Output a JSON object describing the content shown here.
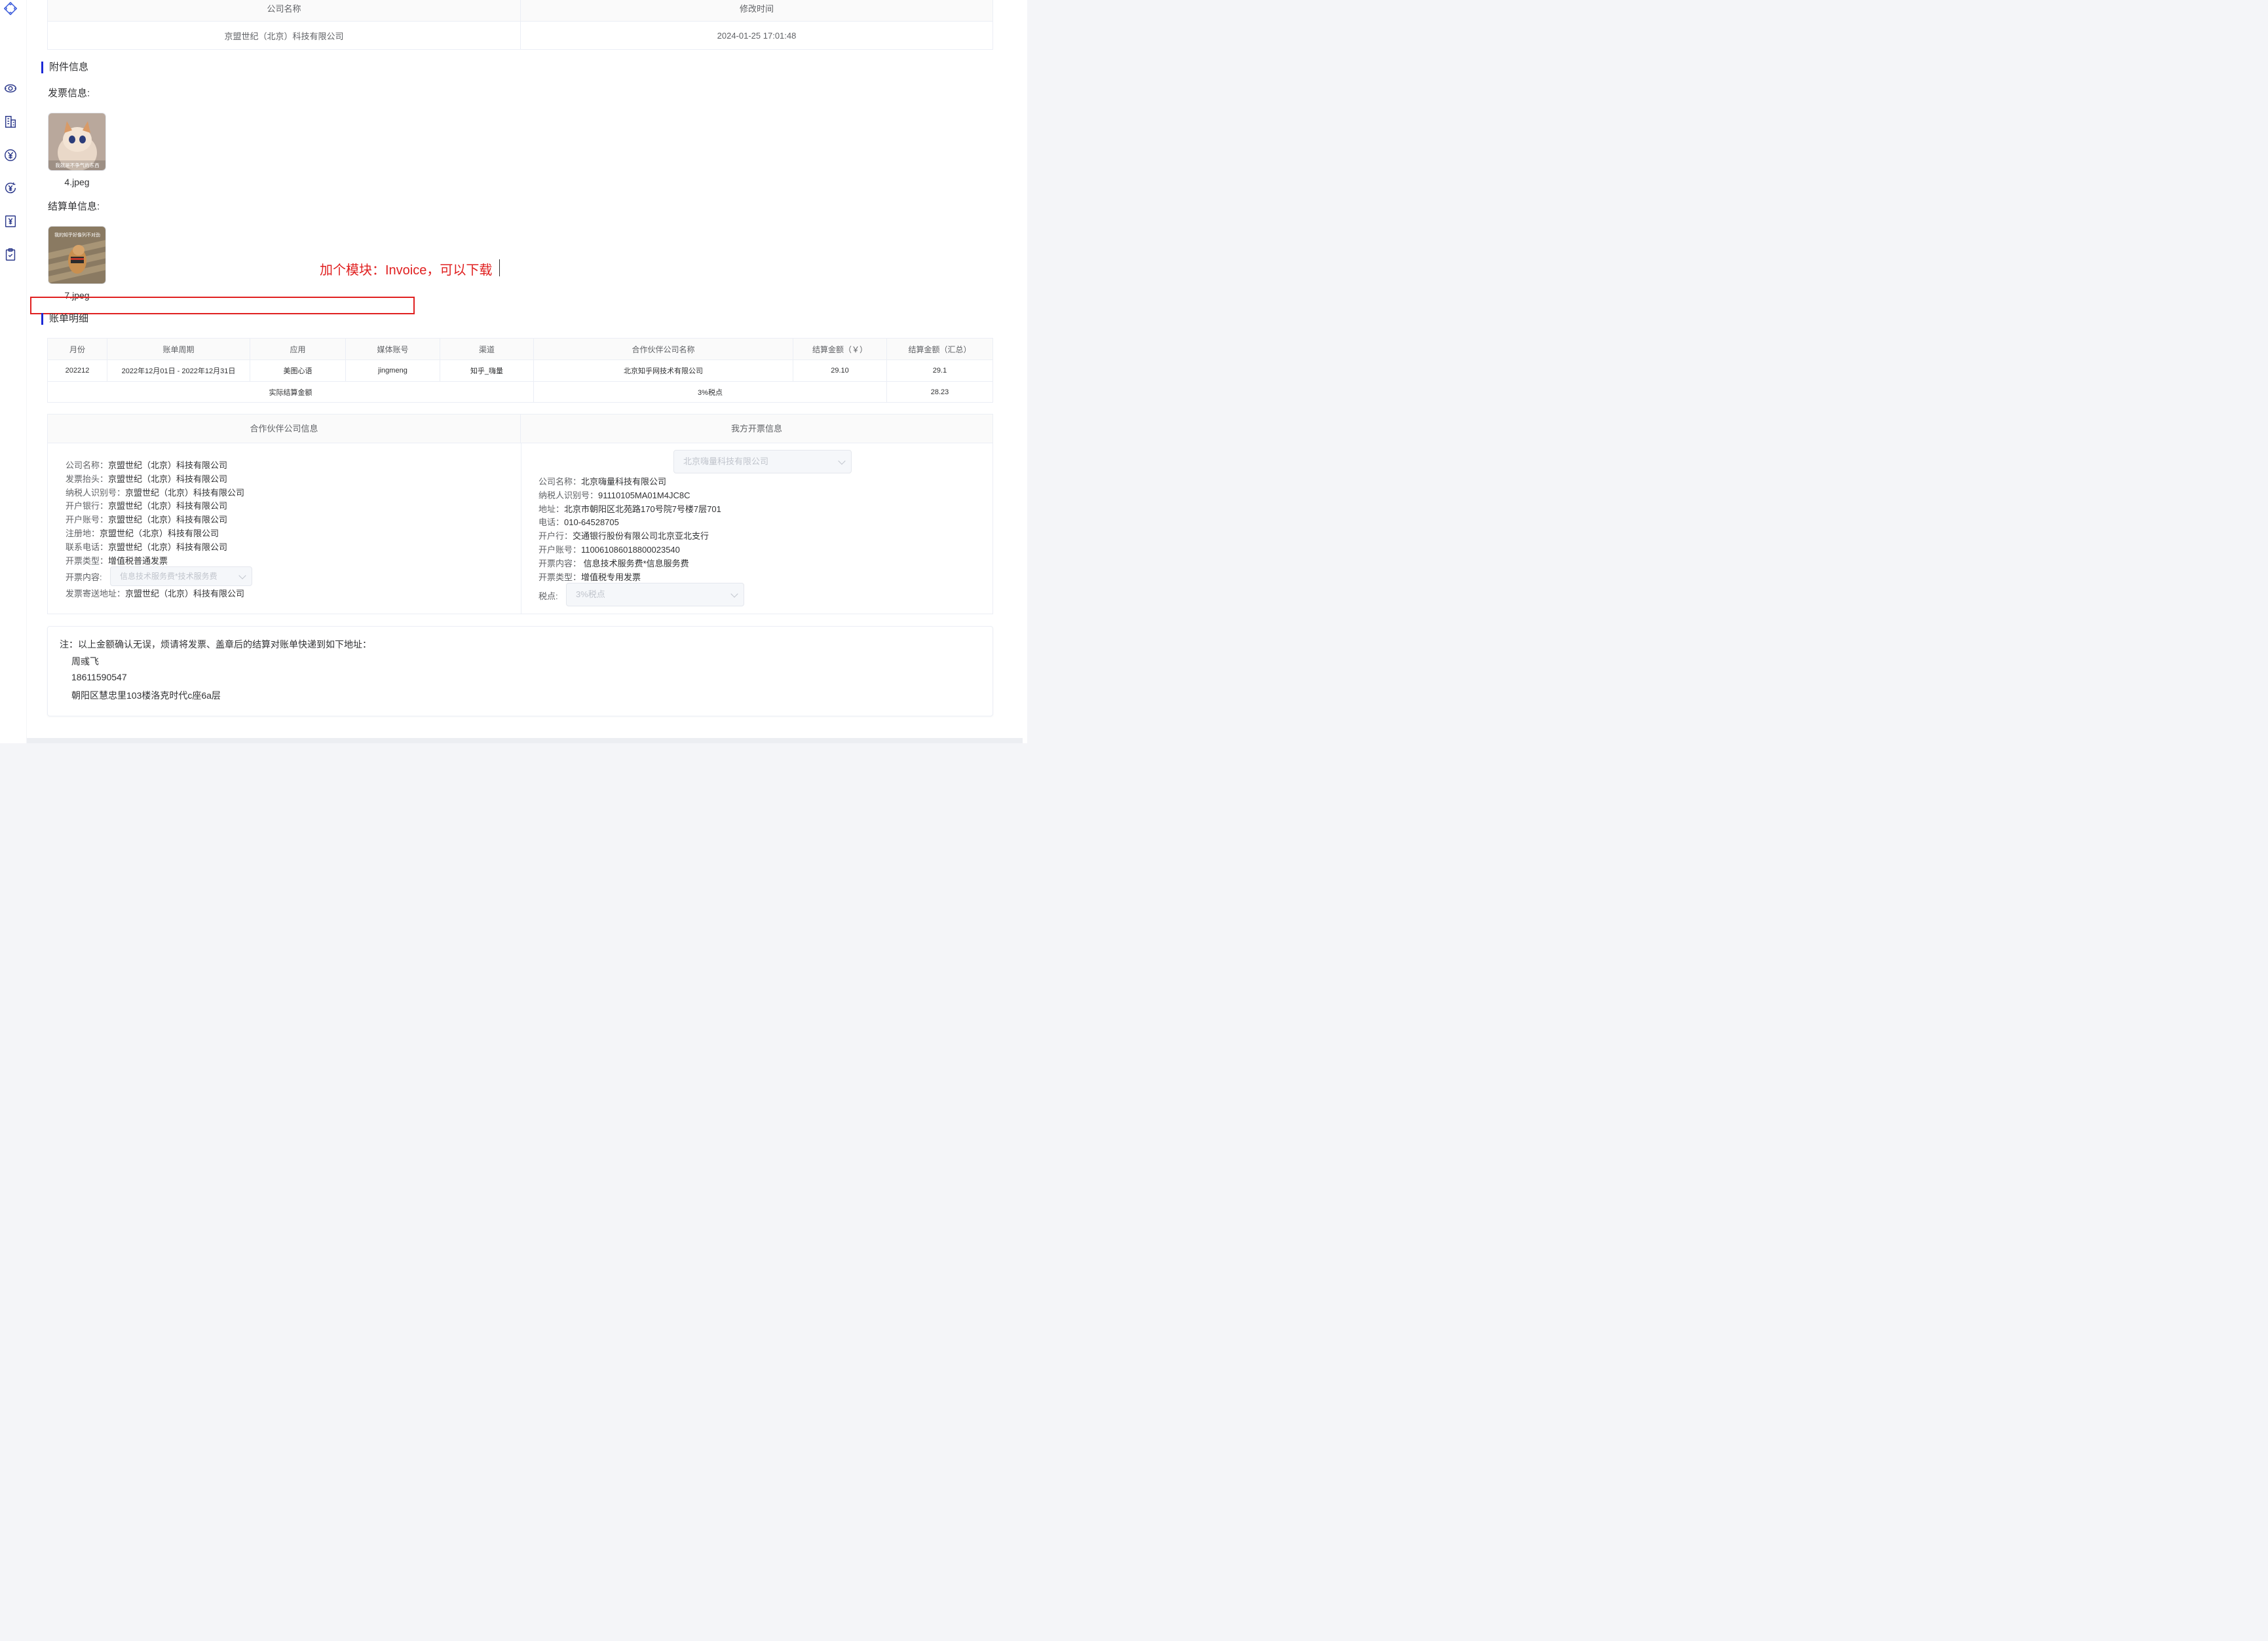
{
  "company_table": {
    "headers": [
      "公司名称",
      "修改时间"
    ],
    "row": [
      "京盟世纪（北京）科技有限公司",
      "2024-01-25 17:01:48"
    ]
  },
  "attachments": {
    "title": "附件信息",
    "invoice_label": "发票信息:",
    "invoice_file": "4.jpeg",
    "invoice_thumb_caption": "我就是不争气的东西",
    "statement_label": "结算单信息:",
    "statement_file": "7.jpeg",
    "statement_thumb_caption": "我的知乎好像列不对劲"
  },
  "annotation": {
    "text": "加个模块：Invoice，可以下载",
    "color": "#e02020"
  },
  "bill": {
    "title": "账单明细",
    "headers": [
      "月份",
      "账单周期",
      "应用",
      "媒体账号",
      "渠道",
      "合作伙伴公司名称",
      "结算金额（￥）",
      "结算金额（汇总）"
    ],
    "rows": [
      [
        "202212",
        "2022年12月01日 - 2022年12月31日",
        "美图心语",
        "jingmeng",
        "知乎_嗨量",
        "北京知乎网技术有限公司",
        "29.10",
        "29.1"
      ]
    ],
    "summary": {
      "label": "实际结算金额",
      "tax": "3%税点",
      "total": "28.23"
    }
  },
  "partner_info": {
    "header": "合作伙伴公司信息",
    "lines": [
      {
        "k": "公司名称：",
        "v": "京盟世纪（北京）科技有限公司"
      },
      {
        "k": "发票抬头：",
        "v": "京盟世纪（北京）科技有限公司"
      },
      {
        "k": "纳税人识别号：",
        "v": "京盟世纪（北京）科技有限公司"
      },
      {
        "k": "开户银行：",
        "v": "京盟世纪（北京）科技有限公司"
      },
      {
        "k": "开户账号：",
        "v": "京盟世纪（北京）科技有限公司"
      },
      {
        "k": "注册地：",
        "v": "京盟世纪（北京）科技有限公司"
      },
      {
        "k": "联系电话：",
        "v": "京盟世纪（北京）科技有限公司"
      },
      {
        "k": "开票类型：",
        "v": "增值税普通发票"
      }
    ],
    "content_label": "开票内容:",
    "content_placeholder": "信息技术服务费*技术服务费",
    "address_label": "发票寄送地址：",
    "address_value": "京盟世纪（北京）科技有限公司"
  },
  "our_info": {
    "header": "我方开票信息",
    "company_select": "北京嗨量科技有限公司",
    "lines": [
      {
        "k": "公司名称：",
        "v": "北京嗨量科技有限公司"
      },
      {
        "k": "纳税人识别号：",
        "v": "91110105MA01M4JC8C"
      },
      {
        "k": "地址：",
        "v": "北京市朝阳区北苑路170号院7号楼7层701"
      },
      {
        "k": "电话：",
        "v": "010-64528705"
      },
      {
        "k": "开户行：",
        "v": "交通银行股份有限公司北京亚北支行"
      },
      {
        "k": "开户账号：",
        "v": "110061086018800023540"
      },
      {
        "k": "开票内容：",
        "v": " 信息技术服务费*信息服务费"
      },
      {
        "k": "开票类型：",
        "v": "增值税专用发票"
      }
    ],
    "tax_label": "税点:",
    "tax_select": "3%税点"
  },
  "note": {
    "intro": "注：以上金额确认无误，烦请将发票、盖章后的结算对账单快递到如下地址：",
    "name": "周彧飞",
    "phone": "18611590547",
    "address": "朝阳区慧忠里103楼洛克时代c座6a层"
  },
  "sidebar_icons": [
    "logo-icon",
    "money-bag-icon",
    "building-icon",
    "yen-circle-icon",
    "yen-refresh-icon",
    "yen-receipt-icon",
    "clipboard-check-icon"
  ]
}
